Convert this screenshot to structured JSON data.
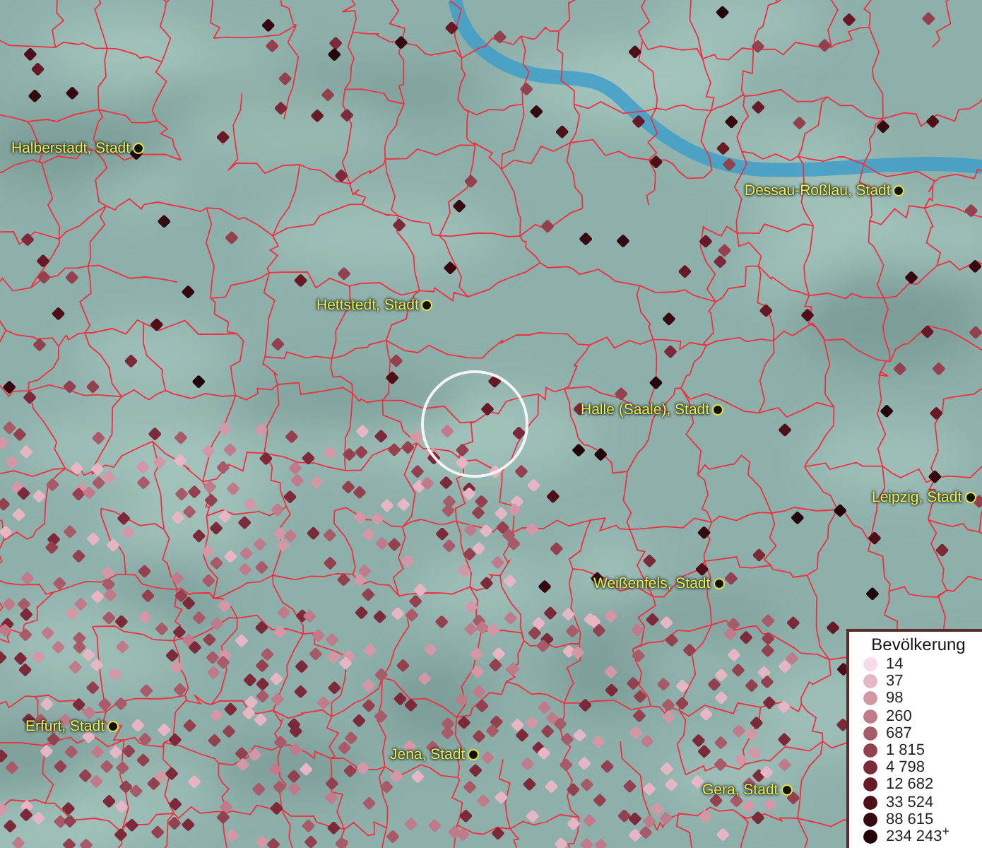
{
  "map": {
    "cities": [
      {
        "label": "Halberstadt, Stadt"
      },
      {
        "label": "Dessau-Roßlau, Stadt"
      },
      {
        "label": "Hettstedt, Stadt"
      },
      {
        "label": "Halle (Saale), Stadt"
      },
      {
        "label": "Leipzig, Stadt"
      },
      {
        "label": "Weißenfels, Stadt"
      },
      {
        "label": "Erfurt, Stadt"
      },
      {
        "label": "Jena, Stadt"
      },
      {
        "label": "Gera, Stadt"
      }
    ]
  },
  "legend": {
    "title": "Bevölkerung",
    "items": [
      {
        "label": "14",
        "color": "#f6dce8"
      },
      {
        "label": "37",
        "color": "#e6b6c4"
      },
      {
        "label": "98",
        "color": "#d397a6"
      },
      {
        "label": "260",
        "color": "#c07b8a"
      },
      {
        "label": "687",
        "color": "#a85a69"
      },
      {
        "label": "1 815",
        "color": "#93404f"
      },
      {
        "label": "4 798",
        "color": "#7c2a39"
      },
      {
        "label": "12 682",
        "color": "#671a26"
      },
      {
        "label": "33 524",
        "color": "#4e0f18"
      },
      {
        "label": "88 615",
        "color": "#360810"
      },
      {
        "label": "234 243$^{+}$",
        "color": "#22040a"
      }
    ]
  }
}
